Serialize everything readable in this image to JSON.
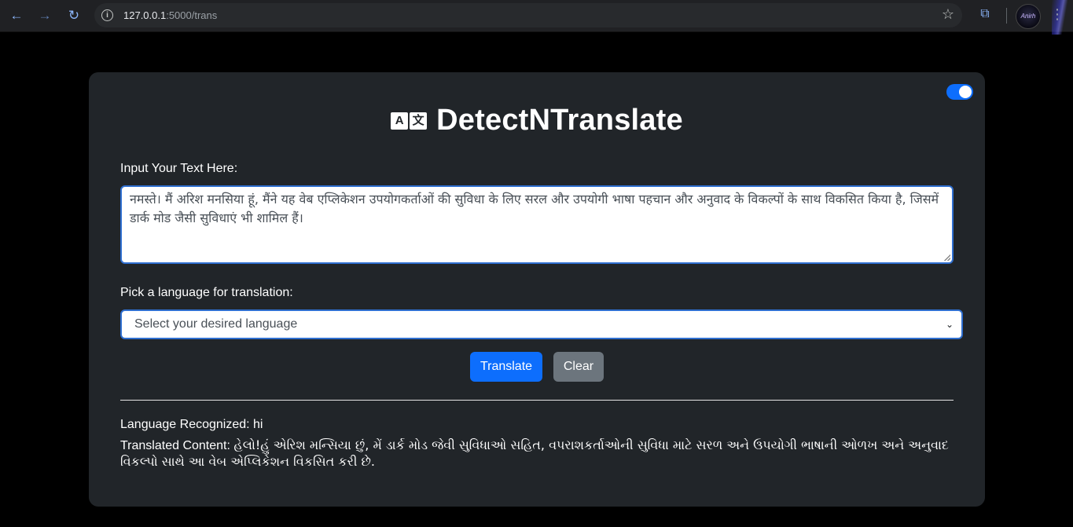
{
  "browser": {
    "url_host": "127.0.0.1",
    "url_rest": ":5000/trans",
    "back_icon": "←",
    "forward_icon": "→",
    "reload_icon": "↻",
    "info_icon": "i",
    "star_icon": "☆",
    "extensions_icon": "⧉",
    "menu_icon": "⋮",
    "avatar_text": "Anirh"
  },
  "app": {
    "title": "DetectNTranslate",
    "title_icon_a": "A",
    "title_icon_b": "文",
    "dark_mode_toggle_on": true,
    "input_label": "Input Your Text Here:",
    "input_text": "नमस्ते। मैं अरिश मनसिया हूं, मैंने यह वेब एप्लिकेशन उपयोगकर्ताओं की सुविधा के लिए सरल और उपयोगी भाषा पहचान और अनुवाद के विकल्पों के साथ विकसित किया है, जिसमें डार्क मोड जैसी सुविधाएं भी शामिल हैं।",
    "language_label": "Pick a language for translation:",
    "language_placeholder": "Select your desired language",
    "chevron_icon": "⌄",
    "translate_button": "Translate",
    "clear_button": "Clear",
    "recognized_text": "Language Recognized: hi",
    "translated_prefix": "Translated Content: ",
    "translated_text": "હેલો!હું એરિશ મન્સિયા છું, મેં ડાર્ક મોડ જેવી સુવિધાઓ સહિત, વપરાશકર્તાઓની સુવિધા માટે સરળ અને ઉપયોગી ભાષાની ઓળખ અને અનુવાદ વિકલ્પો સાથે આ વેબ એપ્લિકેશન વિકસિત કરી છે."
  },
  "colors": {
    "accent": "#0d6efd",
    "card_bg": "#212529",
    "page_bg": "#000000",
    "secondary": "#6c757d"
  }
}
